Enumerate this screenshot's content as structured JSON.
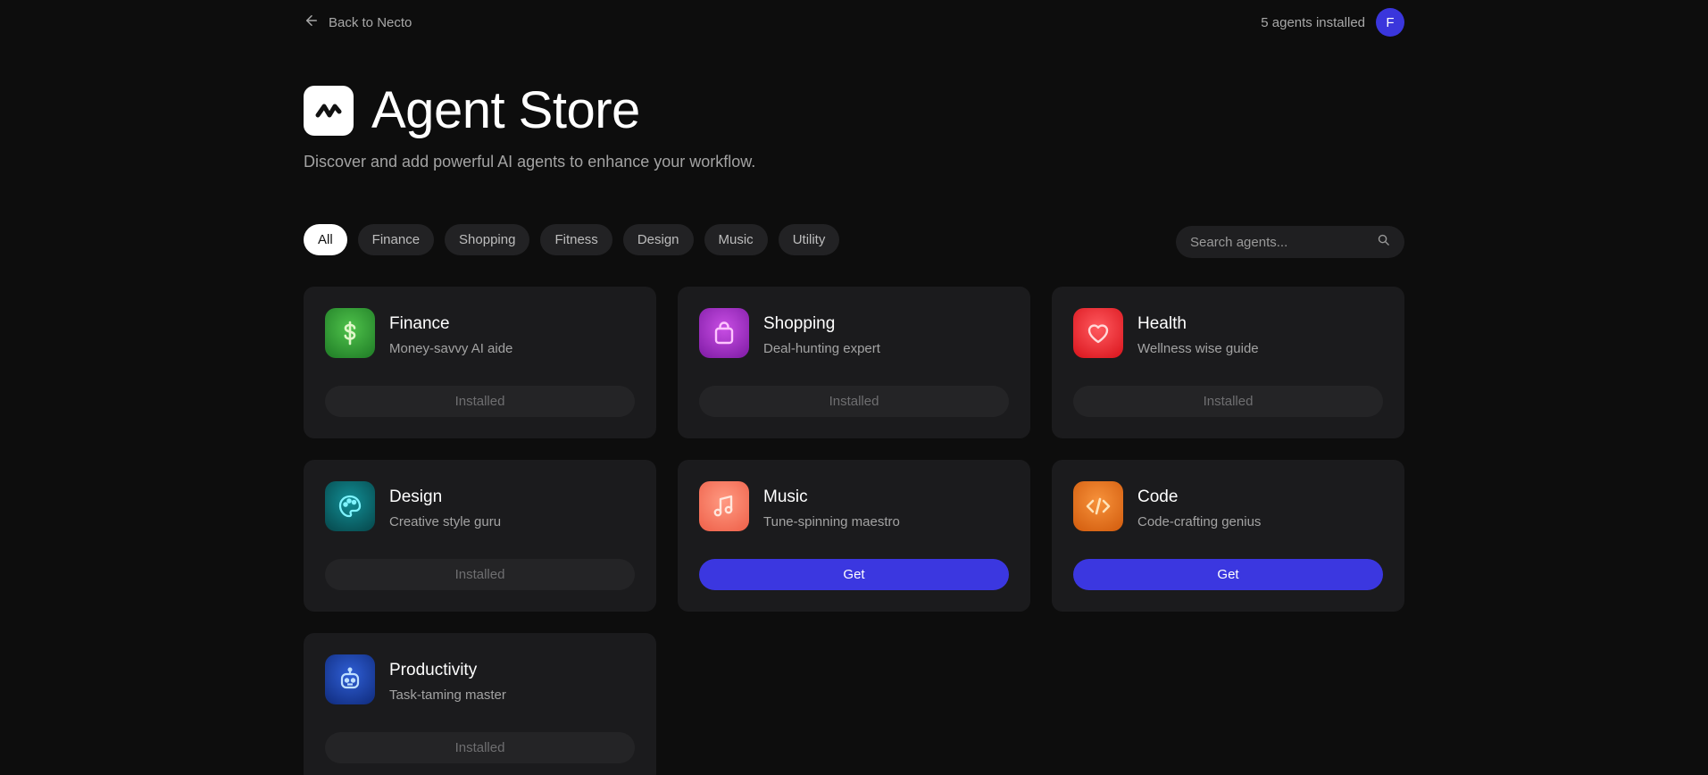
{
  "topbar": {
    "back_label": "Back to Necto",
    "installed_count": "5 agents installed",
    "avatar_initial": "F"
  },
  "hero": {
    "title": "Agent Store",
    "subtitle": "Discover and add powerful AI agents to enhance your workflow."
  },
  "filters": [
    {
      "label": "All",
      "active": true
    },
    {
      "label": "Finance"
    },
    {
      "label": "Shopping"
    },
    {
      "label": "Fitness"
    },
    {
      "label": "Design"
    },
    {
      "label": "Music"
    },
    {
      "label": "Utility"
    }
  ],
  "search": {
    "placeholder": "Search agents..."
  },
  "agents": [
    {
      "name": "Finance",
      "desc": "Money-savvy AI aide",
      "button": "Installed",
      "status": "installed",
      "icon": "dollar-icon",
      "color": "#2f9e3a"
    },
    {
      "name": "Shopping",
      "desc": "Deal-hunting expert",
      "button": "Installed",
      "status": "installed",
      "icon": "shopping-bag-icon",
      "color": "#a229c4"
    },
    {
      "name": "Health",
      "desc": "Wellness wise guide",
      "button": "Installed",
      "status": "installed",
      "icon": "heart-icon",
      "color": "#f0242c"
    },
    {
      "name": "Design",
      "desc": "Creative style guru",
      "button": "Installed",
      "status": "installed",
      "icon": "palette-icon",
      "color": "#0d6d73"
    },
    {
      "name": "Music",
      "desc": "Tune-spinning maestro",
      "button": "Get",
      "status": "available",
      "icon": "music-note-icon",
      "color": "#f2715a"
    },
    {
      "name": "Code",
      "desc": "Code-crafting genius",
      "button": "Get",
      "status": "available",
      "icon": "code-icon",
      "color": "#e56e14"
    },
    {
      "name": "Productivity",
      "desc": "Task-taming master",
      "button": "Installed",
      "status": "installed",
      "icon": "robot-icon",
      "color": "#1c3fa6"
    }
  ],
  "colors": {
    "background": "#0d0d0d",
    "card": "#1b1b1d",
    "accent": "#3b37e0"
  }
}
